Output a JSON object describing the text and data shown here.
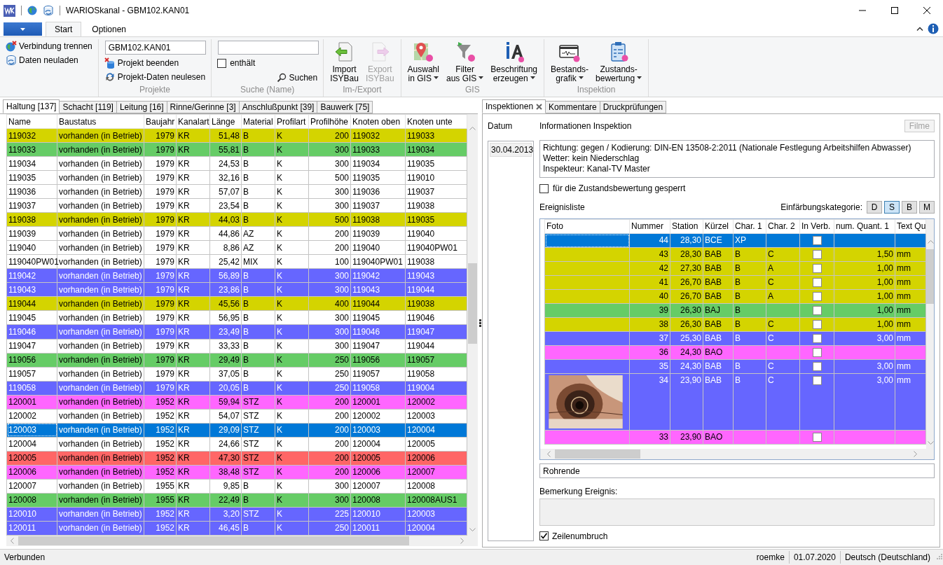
{
  "window": {
    "title": "WARIOSkanal - GBM102.KAN01"
  },
  "ribbon": {
    "tabs": [
      {
        "label": "Start",
        "selected": true
      },
      {
        "label": "Optionen",
        "selected": false
      }
    ],
    "groups": [
      {
        "items": [
          {
            "kind": "small_button",
            "label": "Verbindung trennen"
          },
          {
            "kind": "small_button",
            "label": "Daten neuladen"
          }
        ]
      },
      {
        "label": "Projekte",
        "items": [
          {
            "kind": "field",
            "value": "GBM102.KAN01"
          },
          {
            "kind": "small_button",
            "label": "Projekt beenden"
          },
          {
            "kind": "small_button",
            "label": "Projekt-Daten neulesen"
          }
        ]
      },
      {
        "label": "Suche (Name)",
        "items": [
          {
            "kind": "field"
          },
          {
            "kind": "checkbox",
            "label": "enthält",
            "checked": false
          },
          {
            "kind": "small_button",
            "label": "Suchen"
          }
        ]
      },
      {
        "label": "Im-/Export",
        "items": [
          {
            "kind": "large_button",
            "lines": [
              "Import",
              "ISYBau"
            ],
            "disabled": false,
            "dropdown": false
          },
          {
            "kind": "large_button",
            "lines": [
              "Export",
              "ISYBau"
            ],
            "disabled": true,
            "dropdown": false
          }
        ]
      },
      {
        "label": "GIS",
        "items": [
          {
            "kind": "large_button",
            "lines": [
              "Auswahl",
              "in GIS"
            ],
            "disabled": false,
            "dropdown": true
          },
          {
            "kind": "large_button",
            "lines": [
              "Filter",
              "aus GIS"
            ],
            "disabled": false,
            "dropdown": true
          },
          {
            "kind": "large_button",
            "lines": [
              "Beschriftung",
              "erzeugen"
            ],
            "disabled": false,
            "dropdown": true
          }
        ]
      },
      {
        "label": "Inspektion",
        "items": [
          {
            "kind": "large_button",
            "lines": [
              "Bestands-",
              "grafik"
            ],
            "disabled": false,
            "dropdown": true
          },
          {
            "kind": "large_button",
            "lines": [
              "Zustands-",
              "bewertung"
            ],
            "disabled": false,
            "dropdown": true
          }
        ]
      }
    ]
  },
  "object_tabs": [
    {
      "label": "Haltung [137]",
      "selected": true
    },
    {
      "label": "Schacht [119]",
      "selected": false
    },
    {
      "label": "Leitung [16]",
      "selected": false
    },
    {
      "label": "Rinne/Gerinne [3]",
      "selected": false
    },
    {
      "label": "Anschlußpunkt [39]",
      "selected": false
    },
    {
      "label": "Bauwerk [75]",
      "selected": false
    }
  ],
  "table": {
    "columns": [
      {
        "label": "Name",
        "kind": "text"
      },
      {
        "label": "Baustatus",
        "kind": "text"
      },
      {
        "label": "Baujahr",
        "kind": "number"
      },
      {
        "label": "Kanalart",
        "kind": "text"
      },
      {
        "label": "Länge",
        "kind": "number"
      },
      {
        "label": "Material",
        "kind": "text"
      },
      {
        "label": "Profilart",
        "kind": "text"
      },
      {
        "label": "Profilhöhe",
        "kind": "number"
      },
      {
        "label": "Knoten oben",
        "kind": "text"
      },
      {
        "label": "Knoten unte",
        "kind": "text"
      }
    ],
    "rows": [
      {
        "cells": [
          "119032",
          "vorhanden (in Betrieb)",
          "1979",
          "KR",
          "51,48",
          "B",
          "K",
          "200",
          "119032",
          "119033"
        ],
        "color": "#d4d400",
        "selected": false
      },
      {
        "cells": [
          "119033",
          "vorhanden (in Betrieb)",
          "1979",
          "KR",
          "55,81",
          "B",
          "K",
          "300",
          "119033",
          "119034"
        ],
        "color": "#66cc66",
        "selected": false
      },
      {
        "cells": [
          "119034",
          "vorhanden (in Betrieb)",
          "1979",
          "KR",
          "24,53",
          "B",
          "K",
          "300",
          "119034",
          "119035"
        ],
        "color": "#ffffff",
        "selected": false
      },
      {
        "cells": [
          "119035",
          "vorhanden (in Betrieb)",
          "1979",
          "KR",
          "32,16",
          "B",
          "K",
          "500",
          "119035",
          "119010"
        ],
        "color": "#ffffff",
        "selected": false
      },
      {
        "cells": [
          "119036",
          "vorhanden (in Betrieb)",
          "1979",
          "KR",
          "57,07",
          "B",
          "K",
          "300",
          "119036",
          "119037"
        ],
        "color": "#ffffff",
        "selected": false
      },
      {
        "cells": [
          "119037",
          "vorhanden (in Betrieb)",
          "1979",
          "KR",
          "23,54",
          "B",
          "K",
          "300",
          "119037",
          "119038"
        ],
        "color": "#ffffff",
        "selected": false
      },
      {
        "cells": [
          "119038",
          "vorhanden (in Betrieb)",
          "1979",
          "KR",
          "44,03",
          "B",
          "K",
          "500",
          "119038",
          "119035"
        ],
        "color": "#d4d400",
        "selected": false
      },
      {
        "cells": [
          "119039",
          "vorhanden (in Betrieb)",
          "1979",
          "KR",
          "44,86",
          "AZ",
          "K",
          "200",
          "119039",
          "119040"
        ],
        "color": "#ffffff",
        "selected": false
      },
      {
        "cells": [
          "119040",
          "vorhanden (in Betrieb)",
          "1979",
          "KR",
          "8,86",
          "AZ",
          "K",
          "200",
          "119040",
          "119040PW01"
        ],
        "color": "#ffffff",
        "selected": false
      },
      {
        "cells": [
          "119040PW01",
          "vorhanden (in Betrieb)",
          "1979",
          "KR",
          "25,42",
          "MIX",
          "K",
          "100",
          "119040PW01",
          "119038"
        ],
        "color": "#ffffff",
        "selected": false
      },
      {
        "cells": [
          "119042",
          "vorhanden (in Betrieb)",
          "1979",
          "KR",
          "56,89",
          "B",
          "K",
          "300",
          "119042",
          "119043"
        ],
        "color": "#6666ff",
        "selected": false
      },
      {
        "cells": [
          "119043",
          "vorhanden (in Betrieb)",
          "1979",
          "KR",
          "23,86",
          "B",
          "K",
          "300",
          "119043",
          "119044"
        ],
        "color": "#6666ff",
        "selected": false
      },
      {
        "cells": [
          "119044",
          "vorhanden (in Betrieb)",
          "1979",
          "KR",
          "45,56",
          "B",
          "K",
          "400",
          "119044",
          "119038"
        ],
        "color": "#d4d400",
        "selected": false
      },
      {
        "cells": [
          "119045",
          "vorhanden (in Betrieb)",
          "1979",
          "KR",
          "56,95",
          "B",
          "K",
          "300",
          "119045",
          "119046"
        ],
        "color": "#ffffff",
        "selected": false
      },
      {
        "cells": [
          "119046",
          "vorhanden (in Betrieb)",
          "1979",
          "KR",
          "23,49",
          "B",
          "K",
          "300",
          "119046",
          "119047"
        ],
        "color": "#6666ff",
        "selected": false
      },
      {
        "cells": [
          "119047",
          "vorhanden (in Betrieb)",
          "1979",
          "KR",
          "33,33",
          "B",
          "K",
          "300",
          "119047",
          "119044"
        ],
        "color": "#ffffff",
        "selected": false
      },
      {
        "cells": [
          "119056",
          "vorhanden (in Betrieb)",
          "1979",
          "KR",
          "29,49",
          "B",
          "K",
          "250",
          "119056",
          "119057"
        ],
        "color": "#66cc66",
        "selected": false
      },
      {
        "cells": [
          "119057",
          "vorhanden (in Betrieb)",
          "1979",
          "KR",
          "37,05",
          "B",
          "K",
          "250",
          "119057",
          "119058"
        ],
        "color": "#ffffff",
        "selected": false
      },
      {
        "cells": [
          "119058",
          "vorhanden (in Betrieb)",
          "1979",
          "KR",
          "20,05",
          "B",
          "K",
          "250",
          "119058",
          "119004"
        ],
        "color": "#6666ff",
        "selected": false
      },
      {
        "cells": [
          "120001",
          "vorhanden (in Betrieb)",
          "1952",
          "KR",
          "59,94",
          "STZ",
          "K",
          "200",
          "120001",
          "120002"
        ],
        "color": "#ff66ff",
        "selected": false
      },
      {
        "cells": [
          "120002",
          "vorhanden (in Betrieb)",
          "1952",
          "KR",
          "54,07",
          "STZ",
          "K",
          "200",
          "120002",
          "120003"
        ],
        "color": "#ffffff",
        "selected": false
      },
      {
        "cells": [
          "120003",
          "vorhanden (in Betrieb)",
          "1952",
          "KR",
          "29,09",
          "STZ",
          "K",
          "200",
          "120003",
          "120004"
        ],
        "color": "#0078d7",
        "selected": true
      },
      {
        "cells": [
          "120004",
          "vorhanden (in Betrieb)",
          "1952",
          "KR",
          "24,66",
          "STZ",
          "K",
          "200",
          "120004",
          "120005"
        ],
        "color": "#ffffff",
        "selected": false
      },
      {
        "cells": [
          "120005",
          "vorhanden (in Betrieb)",
          "1952",
          "KR",
          "47,30",
          "STZ",
          "K",
          "200",
          "120005",
          "120006"
        ],
        "color": "#ff6666",
        "selected": false
      },
      {
        "cells": [
          "120006",
          "vorhanden (in Betrieb)",
          "1952",
          "KR",
          "38,48",
          "STZ",
          "K",
          "200",
          "120006",
          "120007"
        ],
        "color": "#ff66ff",
        "selected": false
      },
      {
        "cells": [
          "120007",
          "vorhanden (in Betrieb)",
          "1955",
          "KR",
          "9,85",
          "B",
          "K",
          "300",
          "120007",
          "120008"
        ],
        "color": "#ffffff",
        "selected": false
      },
      {
        "cells": [
          "120008",
          "vorhanden (in Betrieb)",
          "1955",
          "KR",
          "22,49",
          "B",
          "K",
          "300",
          "120008",
          "120008AUS1"
        ],
        "color": "#66cc66",
        "selected": false
      },
      {
        "cells": [
          "120010",
          "vorhanden (in Betrieb)",
          "1952",
          "KR",
          "3,20",
          "STZ",
          "K",
          "225",
          "120010",
          "120003"
        ],
        "color": "#6666ff",
        "selected": false
      },
      {
        "cells": [
          "120011",
          "vorhanden (in Betrieb)",
          "1952",
          "KR",
          "46,45",
          "B",
          "K",
          "250",
          "120011",
          "120004"
        ],
        "color": "#6666ff",
        "selected": false
      }
    ]
  },
  "detail_tabs": [
    {
      "label": "Inspektionen",
      "selected": true,
      "closable": true
    },
    {
      "label": "Kommentare",
      "selected": false,
      "closable": false
    },
    {
      "label": "Druckprüfungen",
      "selected": false,
      "closable": false
    }
  ],
  "datum": {
    "label": "Datum",
    "items": [
      {
        "label": "30.04.2013",
        "selected": true
      }
    ]
  },
  "info": {
    "title": "Informationen Inspektion",
    "filme_button": {
      "label": "Filme",
      "disabled": true
    },
    "lines": [
      "Richtung: gegen / Kodierung: DIN-EN 13508-2:2011 (Nationale Festlegung Arbeitshilfen Abwasser)",
      "Wetter: kein Niederschlag",
      "Inspekteur: Kanal-TV Master"
    ]
  },
  "locked": {
    "label": "für die Zustandsbewertung gesperrt",
    "checked": false
  },
  "events": {
    "title": "Ereignisliste",
    "category_label": "Einfärbungskategorie:",
    "categories": [
      {
        "label": "D",
        "selected": false
      },
      {
        "label": "S",
        "selected": true
      },
      {
        "label": "B",
        "selected": false
      },
      {
        "label": "M",
        "selected": false
      }
    ],
    "columns": [
      "Foto",
      "Nummer",
      "Station",
      "Kürzel",
      "Char. 1",
      "Char. 2",
      "In Verb.",
      "num. Quant. 1",
      "Text Qu"
    ],
    "rows": [
      {
        "number": "44",
        "station": "28,30",
        "code": "BCE",
        "char_1": "XP",
        "in_verb": false,
        "color": "#0078d7",
        "selected": true
      },
      {
        "number": "43",
        "station": "28,30",
        "code": "BAB",
        "char_1": "B",
        "char_2": "C",
        "in_verb": false,
        "quantity": "1,50",
        "unit": "mm",
        "color": "#d4d400",
        "selected": false
      },
      {
        "number": "42",
        "station": "27,30",
        "code": "BAB",
        "char_1": "B",
        "char_2": "A",
        "in_verb": false,
        "quantity": "1,00",
        "unit": "mm",
        "color": "#d4d400",
        "selected": false
      },
      {
        "number": "41",
        "station": "26,70",
        "code": "BAB",
        "char_1": "B",
        "char_2": "C",
        "in_verb": false,
        "quantity": "1,00",
        "unit": "mm",
        "color": "#d4d400",
        "selected": false
      },
      {
        "number": "40",
        "station": "26,70",
        "code": "BAB",
        "char_1": "B",
        "char_2": "A",
        "in_verb": false,
        "quantity": "1,00",
        "unit": "mm",
        "color": "#d4d400",
        "selected": false
      },
      {
        "number": "39",
        "station": "26,30",
        "code": "BAJ",
        "char_1": "B",
        "in_verb": false,
        "quantity": "1,00",
        "unit": "mm",
        "color": "#66cc66",
        "selected": false
      },
      {
        "number": "38",
        "station": "26,30",
        "code": "BAB",
        "char_1": "B",
        "char_2": "C",
        "in_verb": false,
        "quantity": "1,00",
        "unit": "mm",
        "color": "#d4d400",
        "selected": false
      },
      {
        "number": "37",
        "station": "25,30",
        "code": "BAB",
        "char_1": "B",
        "char_2": "C",
        "in_verb": false,
        "quantity": "3,00",
        "unit": "mm",
        "color": "#6666ff",
        "selected": false
      },
      {
        "number": "36",
        "station": "24,30",
        "code": "BAO",
        "in_verb": false,
        "color": "#ff66ff",
        "selected": false
      },
      {
        "number": "35",
        "station": "24,30",
        "code": "BAB",
        "char_1": "B",
        "char_2": "C",
        "in_verb": false,
        "quantity": "3,00",
        "unit": "mm",
        "color": "#6666ff",
        "selected": false
      },
      {
        "number": "34",
        "station": "23,90",
        "code": "BAB",
        "char_1": "B",
        "char_2": "C",
        "in_verb": false,
        "quantity": "3,00",
        "unit": "mm",
        "color": "#6666ff",
        "selected": false
      },
      {
        "number": "33",
        "station": "23,90",
        "code": "BAO",
        "in_verb": false,
        "color": "#ff66ff",
        "selected": false
      }
    ]
  },
  "event_text": {
    "value": "Rohrende"
  },
  "remark": {
    "label": "Bemerkung Ereignis:",
    "disabled": true
  },
  "wrap": {
    "label": "Zeilenumbruch",
    "checked": true
  },
  "status_bar": {
    "left": "Verbunden",
    "items": [
      "roemke",
      "01.07.2020",
      "Deutsch (Deutschland)"
    ]
  }
}
